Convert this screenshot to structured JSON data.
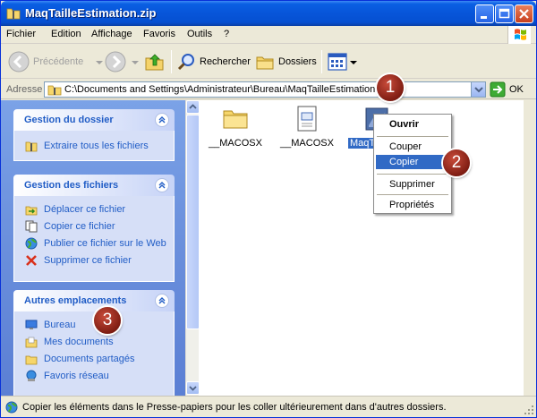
{
  "window": {
    "title": "MaqTailleEstimation.zip"
  },
  "menu": {
    "items": [
      {
        "label": "Fichier"
      },
      {
        "label": "Edition"
      },
      {
        "label": "Affichage"
      },
      {
        "label": "Favoris"
      },
      {
        "label": "Outils"
      },
      {
        "label": "?"
      }
    ]
  },
  "toolbar": {
    "back_label": "Précédente",
    "search_label": "Rechercher",
    "folders_label": "Dossiers"
  },
  "address": {
    "label": "Adresse",
    "value": "C:\\Documents and Settings\\Administrateur\\Bureau\\MaqTailleEstimation.zip",
    "go_label": "OK"
  },
  "taskpane": {
    "folder_tasks": {
      "title": "Gestion du dossier",
      "items": [
        {
          "label": "Extraire tous les fichiers",
          "icon": "extract-icon"
        }
      ]
    },
    "file_tasks": {
      "title": "Gestion des fichiers",
      "items": [
        {
          "label": "Déplacer ce fichier",
          "icon": "move-icon"
        },
        {
          "label": "Copier ce fichier",
          "icon": "copy-icon"
        },
        {
          "label": "Publier ce fichier sur le Web",
          "icon": "globe-icon"
        },
        {
          "label": "Supprimer ce fichier",
          "icon": "delete-icon"
        }
      ]
    },
    "other_places": {
      "title": "Autres emplacements",
      "items": [
        {
          "label": "Bureau",
          "icon": "desktop-icon"
        },
        {
          "label": "Mes documents",
          "icon": "my-documents-icon"
        },
        {
          "label": "Documents partagés",
          "icon": "shared-folder-icon"
        },
        {
          "label": "Favoris réseau",
          "icon": "network-icon"
        }
      ]
    }
  },
  "files": [
    {
      "label": "__MACOSX",
      "icon": "folder-icon"
    },
    {
      "label": "__MACOSX",
      "icon": "file-icon"
    },
    {
      "label": "MaqT",
      "icon": "image-file-icon",
      "selected": true
    }
  ],
  "context_menu": {
    "items": [
      {
        "label": "Ouvrir",
        "bold": true
      },
      {
        "label": "Couper"
      },
      {
        "label": "Copier",
        "selected": true
      },
      {
        "label": "Supprimer"
      },
      {
        "label": "Propriétés"
      }
    ]
  },
  "callouts": [
    "1",
    "2",
    "3"
  ],
  "status": {
    "text": "Copier les éléments dans le Presse-papiers pour les coller ultérieurement dans d'autres dossiers."
  },
  "colors": {
    "titlebar": "#0755d9",
    "taskpane": "#6a8fdc",
    "panel_title": "#215dc6",
    "selection": "#316ac5",
    "callout": "#9c2a1c"
  }
}
